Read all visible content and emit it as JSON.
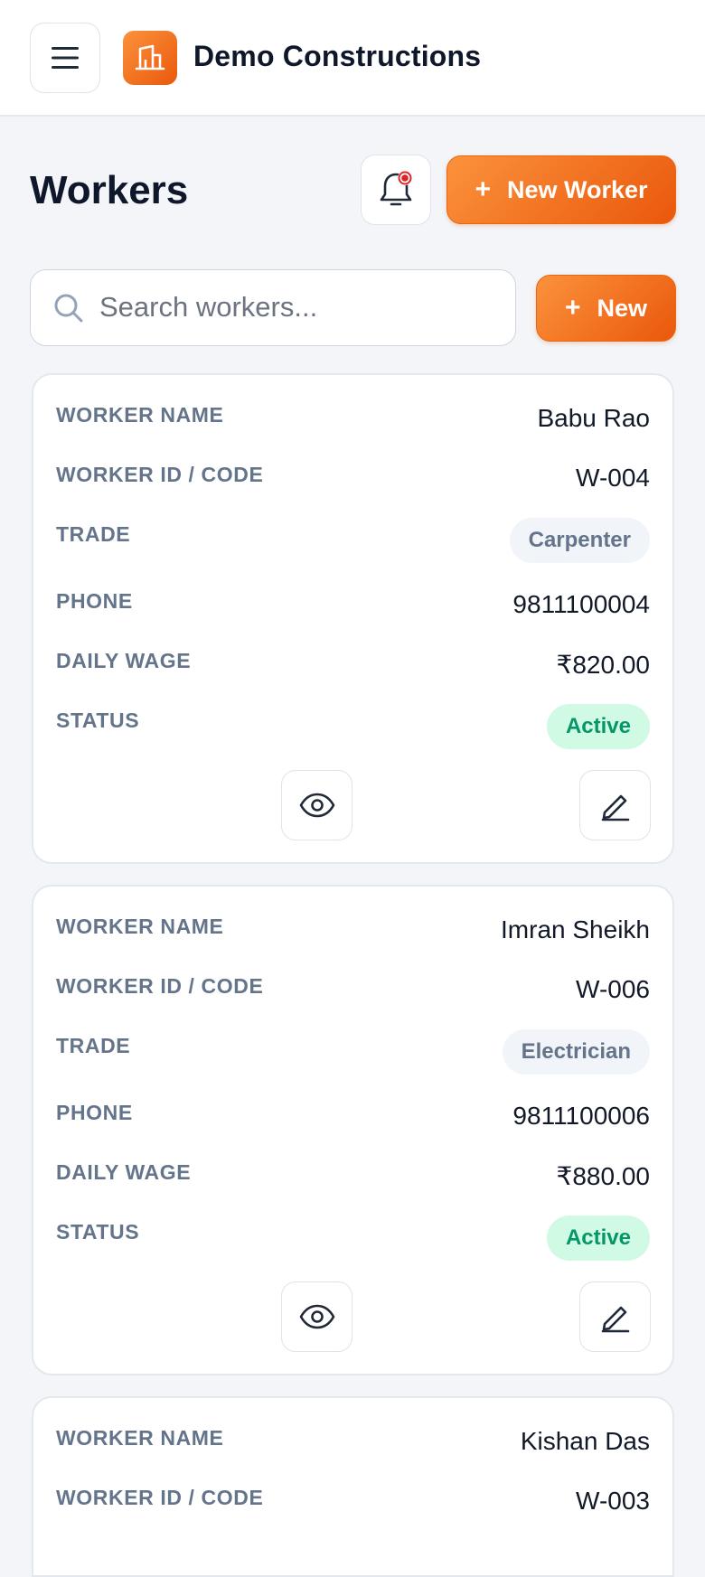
{
  "header": {
    "brand_name": "Demo Constructions",
    "menu_icon": "hamburger-menu-icon",
    "logo_icon": "building-icon"
  },
  "page": {
    "title": "Workers",
    "bell_icon": "bell-icon",
    "new_worker_label": "New Worker",
    "new_label": "New"
  },
  "search": {
    "placeholder": "Search workers...",
    "value": ""
  },
  "labels": {
    "name": "WORKER NAME",
    "code": "WORKER ID / CODE",
    "trade": "TRADE",
    "phone": "PHONE",
    "wage": "DAILY WAGE",
    "status": "STATUS"
  },
  "workers": [
    {
      "name": "Babu Rao",
      "code": "W-004",
      "trade": "Carpenter",
      "phone": "9811100004",
      "wage": "₹820.00",
      "status": "Active"
    },
    {
      "name": "Imran Sheikh",
      "code": "W-006",
      "trade": "Electrician",
      "phone": "9811100006",
      "wage": "₹880.00",
      "status": "Active"
    },
    {
      "name": "Kishan Das",
      "code": "W-003"
    }
  ],
  "colors": {
    "accent": "#ea580c",
    "accent_light": "#fb923c",
    "active_bg": "#d1fae5",
    "active_text": "#059669",
    "label_text": "#64748b"
  }
}
